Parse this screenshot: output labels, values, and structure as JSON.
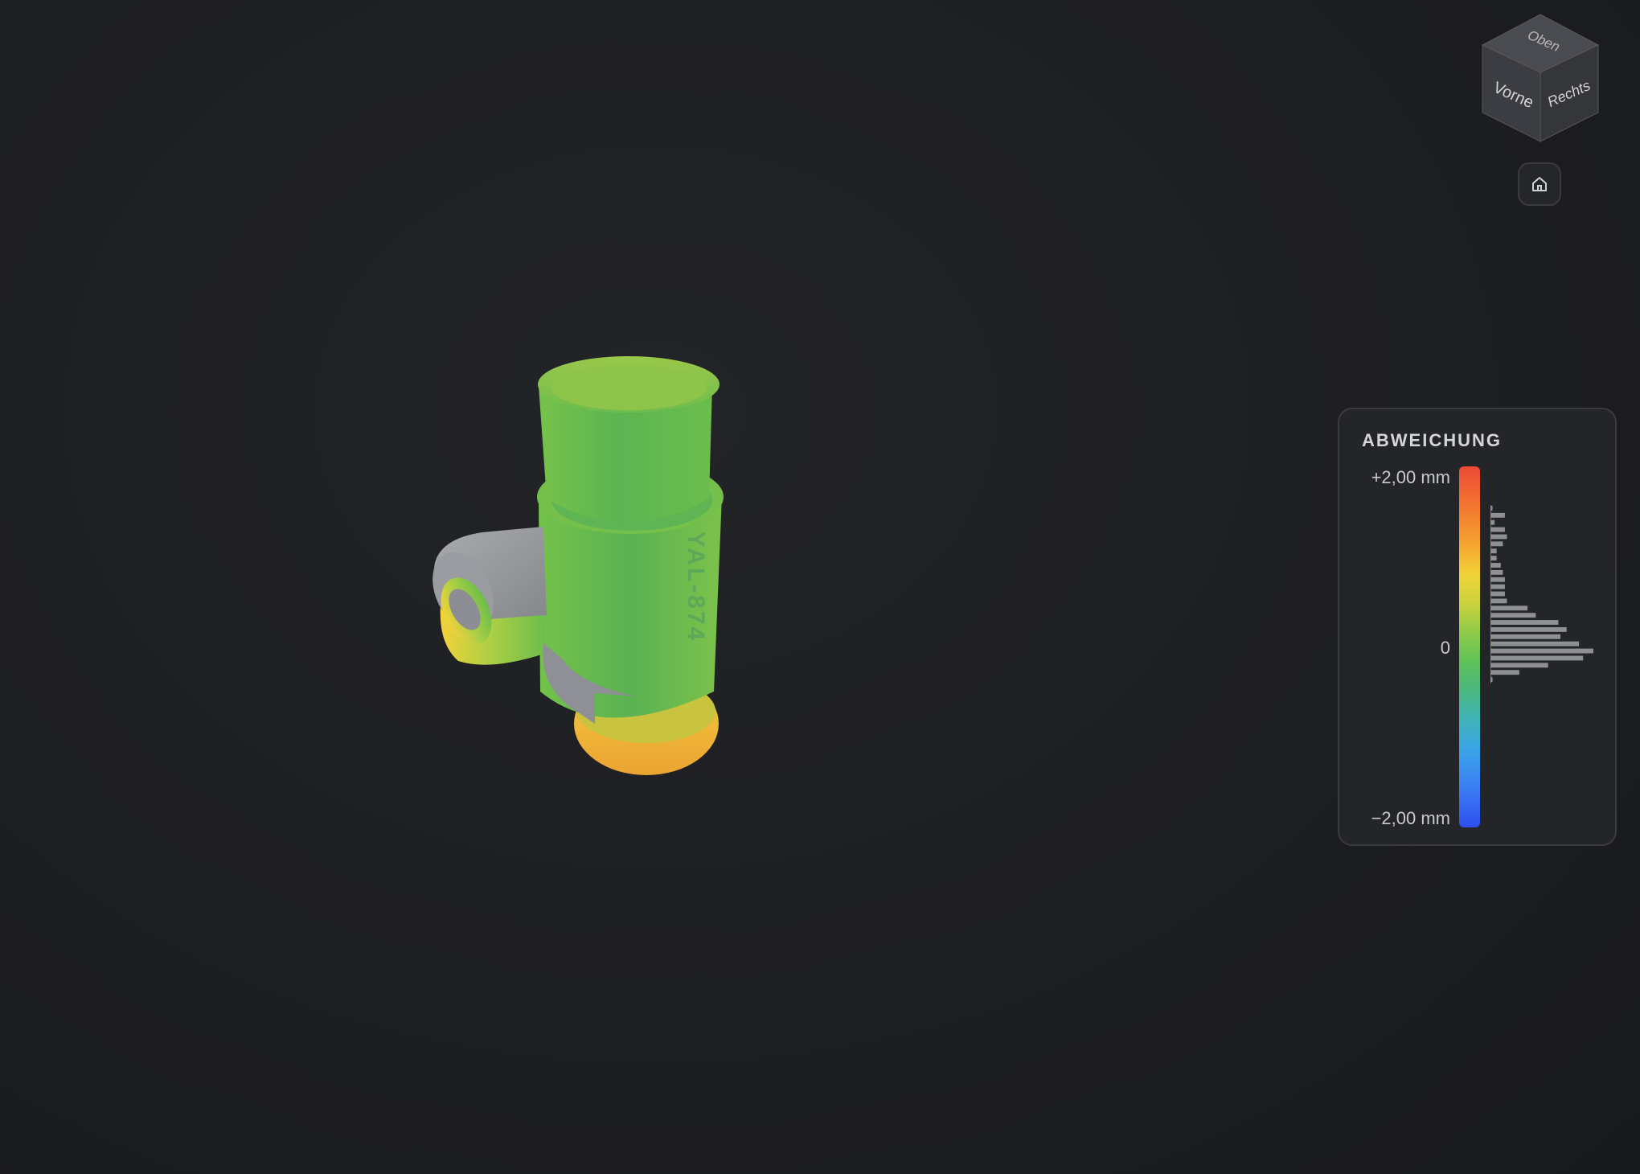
{
  "viewer": {
    "part_engraving": "YAL-874"
  },
  "view_cube": {
    "top_label": "Oben",
    "front_label": "Vorne",
    "right_label": "Rechts"
  },
  "home_button": {
    "icon": "home-icon"
  },
  "legend": {
    "title": "ABWEICHUNG",
    "max_label": "+2,00 mm",
    "zero_label": "0",
    "min_label": "−2,00 mm",
    "scale_colors": [
      "#ee4a36",
      "#f6a630",
      "#f0d437",
      "#8ecb48",
      "#5fc257",
      "#3fb3b6",
      "#3aa6e6",
      "#2e4ff0"
    ],
    "histogram_relative_counts": [
      0.02,
      0.14,
      0.04,
      0.14,
      0.16,
      0.12,
      0.06,
      0.06,
      0.1,
      0.12,
      0.14,
      0.14,
      0.14,
      0.16,
      0.36,
      0.44,
      0.66,
      0.74,
      0.68,
      0.86,
      1.0,
      0.9,
      0.56,
      0.28,
      0.02
    ]
  }
}
